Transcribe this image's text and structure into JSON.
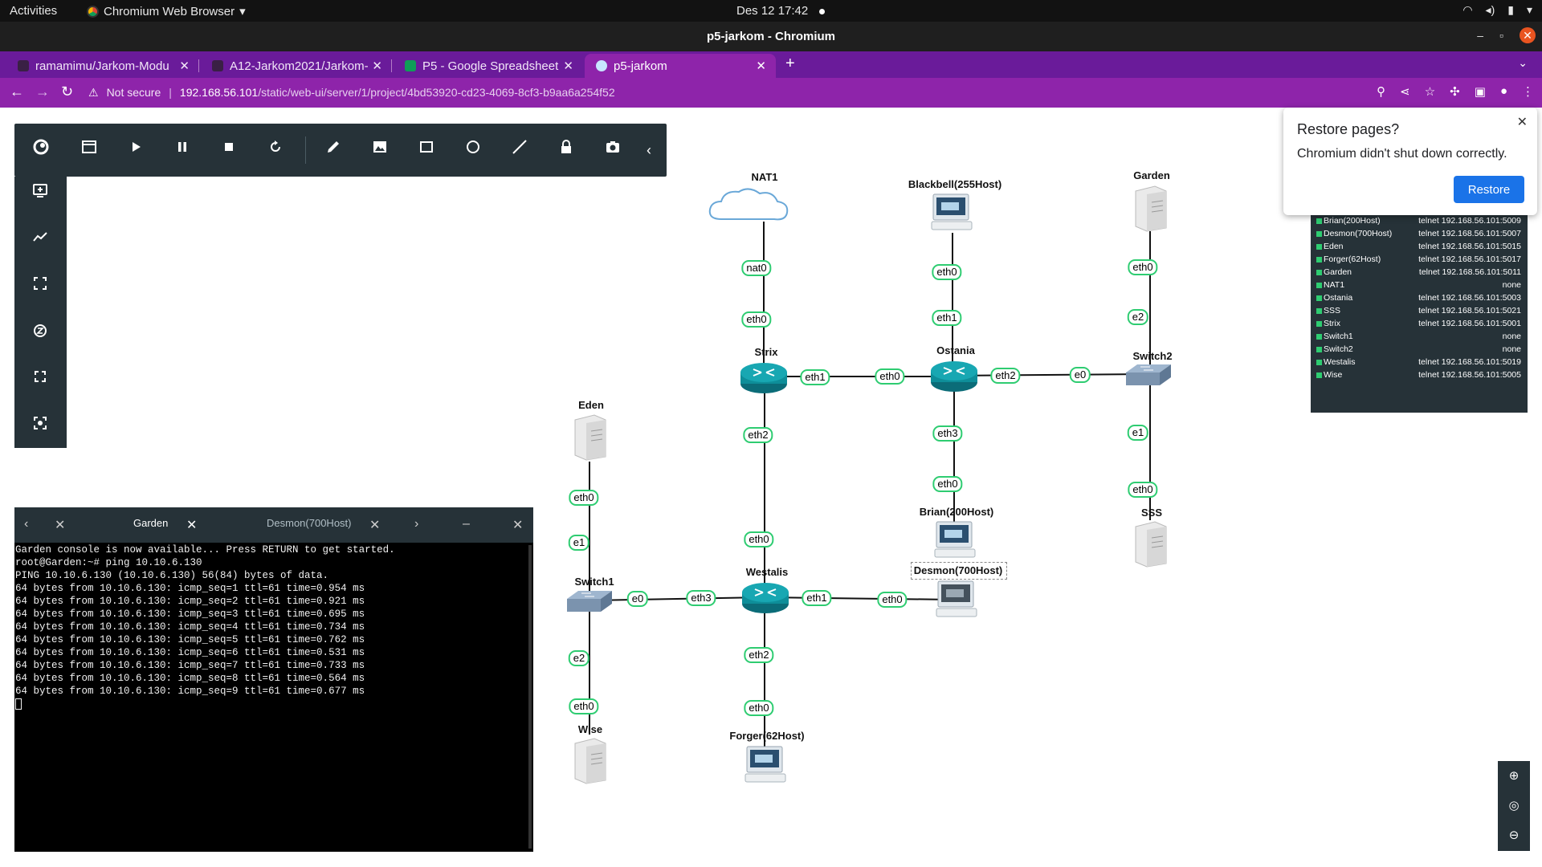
{
  "topbar": {
    "activities": "Activities",
    "app_name": "Chromium Web Browser",
    "clock": "Des 12  17:42"
  },
  "window": {
    "title": "p5-jarkom - Chromium"
  },
  "tabs": [
    {
      "label": "ramamimu/Jarkom-Modu"
    },
    {
      "label": "A12-Jarkom2021/Jarkom-"
    },
    {
      "label": "P5 - Google Spreadsheet"
    },
    {
      "label": "p5-jarkom",
      "active": true
    }
  ],
  "address": {
    "security": "Not secure",
    "host": "192.168.56.101",
    "path": "/static/web-ui/server/1/project/4bd53920-cd23-4069-8cf3-b9aa6a254f52"
  },
  "restore_popup": {
    "title": "Restore pages?",
    "message": "Chromium didn't shut down correctly.",
    "button": "Restore"
  },
  "topology": {
    "nodes": {
      "nat1": "NAT1",
      "blackbell": "Blackbell(255Host)",
      "garden": "Garden",
      "strix": "Strix",
      "ostania": "Ostania",
      "switch2": "Switch2",
      "eden": "Eden",
      "brian": "Brian(200Host)",
      "sss": "SSS",
      "desmon": "Desmon(700Host)",
      "switch1": "Switch1",
      "westalis": "Westalis",
      "wise": "Wise",
      "forger": "Forger(62Host)"
    },
    "interfaces": {
      "nat1_nat0": "nat0",
      "strix_eth0": "eth0",
      "blackbell_eth0": "eth0",
      "ostania_eth1": "eth1",
      "garden_eth0": "eth0",
      "switch2_e2": "e2",
      "strix_eth1": "eth1",
      "ostania_eth0": "eth0",
      "ostania_eth2": "eth2",
      "switch2_e0": "e0",
      "strix_eth2": "eth2",
      "ostania_eth3": "eth3",
      "switch2_e1": "e1",
      "brian_eth0": "eth0",
      "sss_eth0": "eth0",
      "eden_eth0": "eth0",
      "switch1_e1": "e1",
      "westalis_eth0": "eth0",
      "switch1_e0": "e0",
      "westalis_eth3": "eth3",
      "westalis_eth1": "eth1",
      "desmon_eth0": "eth0",
      "switch1_e2": "e2",
      "westalis_eth2": "eth2",
      "wise_eth0": "eth0",
      "forger_eth0": "eth0"
    }
  },
  "node_list": [
    {
      "name": "Brian(200Host)",
      "console": "telnet 192.168.56.101:5009"
    },
    {
      "name": "Desmon(700Host)",
      "console": "telnet 192.168.56.101:5007"
    },
    {
      "name": "Eden",
      "console": "telnet 192.168.56.101:5015"
    },
    {
      "name": "Forger(62Host)",
      "console": "telnet 192.168.56.101:5017"
    },
    {
      "name": "Garden",
      "console": "telnet 192.168.56.101:5011"
    },
    {
      "name": "NAT1",
      "console": "none"
    },
    {
      "name": "Ostania",
      "console": "telnet 192.168.56.101:5003"
    },
    {
      "name": "SSS",
      "console": "telnet 192.168.56.101:5021"
    },
    {
      "name": "Strix",
      "console": "telnet 192.168.56.101:5001"
    },
    {
      "name": "Switch1",
      "console": "none"
    },
    {
      "name": "Switch2",
      "console": "none"
    },
    {
      "name": "Westalis",
      "console": "telnet 192.168.56.101:5019"
    },
    {
      "name": "Wise",
      "console": "telnet 192.168.56.101:5005"
    }
  ],
  "console": {
    "tabs": [
      {
        "label": "Garden",
        "active": true
      },
      {
        "label": "Desmon(700Host)",
        "active": false
      }
    ],
    "lines": [
      "Garden console is now available... Press RETURN to get started.",
      "root@Garden:~# ping 10.10.6.130",
      "PING 10.10.6.130 (10.10.6.130) 56(84) bytes of data.",
      "64 bytes from 10.10.6.130: icmp_seq=1 ttl=61 time=0.954 ms",
      "64 bytes from 10.10.6.130: icmp_seq=2 ttl=61 time=0.921 ms",
      "64 bytes from 10.10.6.130: icmp_seq=3 ttl=61 time=0.695 ms",
      "64 bytes from 10.10.6.130: icmp_seq=4 ttl=61 time=0.734 ms",
      "64 bytes from 10.10.6.130: icmp_seq=5 ttl=61 time=0.762 ms",
      "64 bytes from 10.10.6.130: icmp_seq=6 ttl=61 time=0.531 ms",
      "64 bytes from 10.10.6.130: icmp_seq=7 ttl=61 time=0.733 ms",
      "64 bytes from 10.10.6.130: icmp_seq=8 ttl=61 time=0.564 ms",
      "64 bytes from 10.10.6.130: icmp_seq=9 ttl=61 time=0.677 ms"
    ]
  },
  "colors": {
    "tab_strip": "#6a1b9a",
    "toolbar": "#8e24aa",
    "panel": "#263238",
    "link_label_border": "#2ecc71",
    "router": "#0e8e99",
    "restore_button": "#1a73e8"
  }
}
